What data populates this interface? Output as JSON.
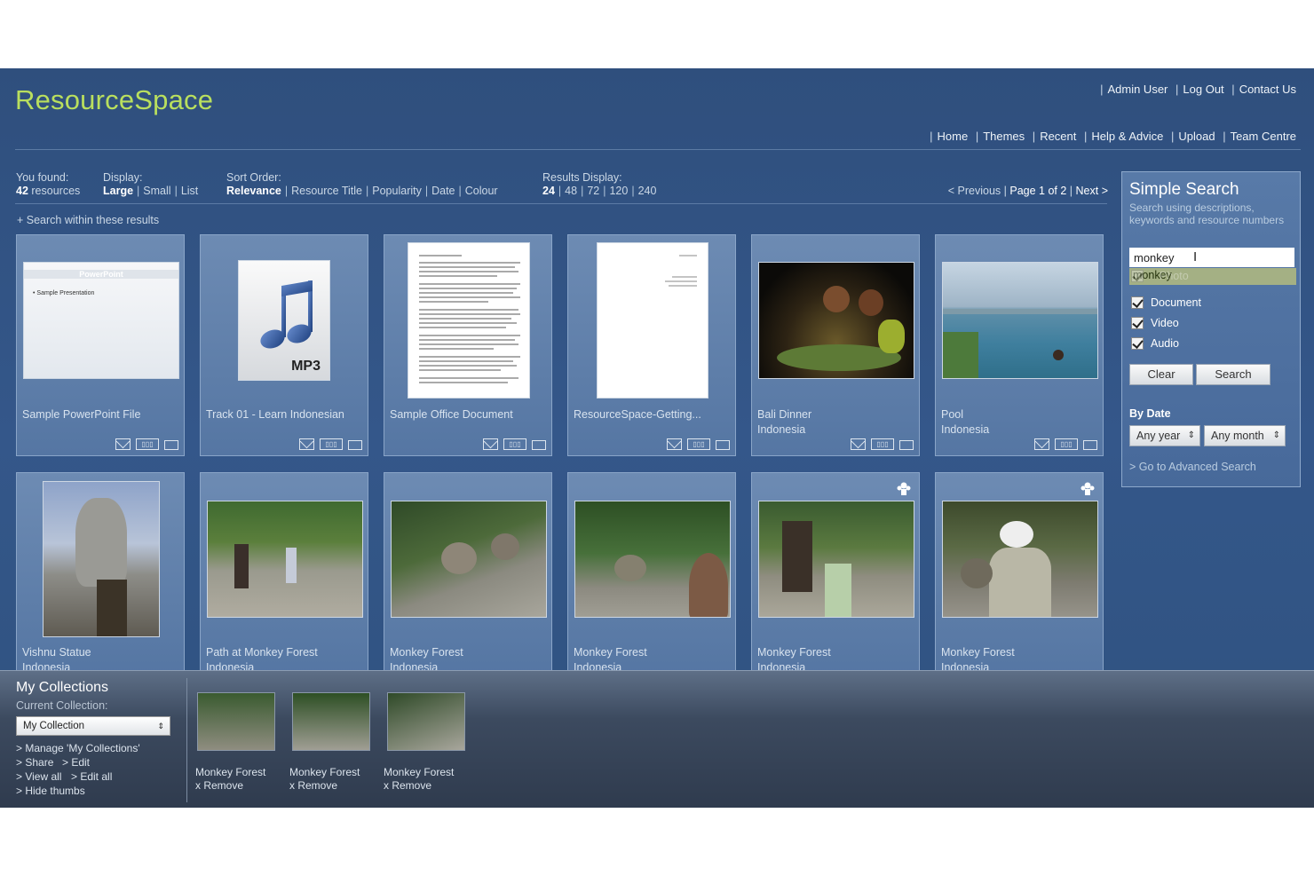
{
  "header": {
    "logo": "ResourceSpace",
    "user_links": [
      "Admin User",
      "Log Out",
      "Contact Us"
    ],
    "nav_links": [
      "Home",
      "Themes",
      "Recent",
      "Help & Advice",
      "Upload",
      "Team Centre"
    ]
  },
  "results_bar": {
    "found_label": "You found:",
    "found_count": "42",
    "found_suffix": "resources",
    "display_label": "Display:",
    "display_options": [
      "Large",
      "Small",
      "List"
    ],
    "sort_label": "Sort Order:",
    "sort_options": [
      "Relevance",
      "Resource Title",
      "Popularity",
      "Date",
      "Colour"
    ],
    "results_display_label": "Results Display:",
    "results_display_options": [
      "24",
      "48",
      "72",
      "120",
      "240"
    ],
    "pager": {
      "previous": "< Previous",
      "page_text": "Page 1 of 2",
      "next": "Next >"
    },
    "search_within": "+ Search within these results"
  },
  "resources": [
    {
      "title": "Sample PowerPoint File",
      "subtitle": "",
      "thumb": "powerpoint"
    },
    {
      "title": "Track 01 - Learn Indonesian",
      "subtitle": "",
      "thumb": "mp3"
    },
    {
      "title": "Sample Office Document",
      "subtitle": "",
      "thumb": "document"
    },
    {
      "title": "ResourceSpace-Getting...",
      "subtitle": "",
      "thumb": "getting-started"
    },
    {
      "title": "Bali Dinner",
      "subtitle": "Indonesia",
      "thumb": "dinner-photo"
    },
    {
      "title": "Pool",
      "subtitle": "Indonesia",
      "thumb": "pool-photo"
    },
    {
      "title": "Vishnu Statue",
      "subtitle": "Indonesia",
      "thumb": "statue-photo"
    },
    {
      "title": "Path at Monkey Forest",
      "subtitle": "Indonesia",
      "thumb": "path-photo"
    },
    {
      "title": "Monkey Forest",
      "subtitle": "Indonesia",
      "thumb": "monkey-photo"
    },
    {
      "title": "Monkey Forest",
      "subtitle": "Indonesia",
      "thumb": "monkey-photo"
    },
    {
      "title": "Monkey Forest",
      "subtitle": "Indonesia",
      "thumb": "forest-walk-photo"
    },
    {
      "title": "Monkey Forest",
      "subtitle": "Indonesia",
      "thumb": "man-monkey-photo"
    }
  ],
  "thumb_text": {
    "powerpoint_title": "PowerPoint",
    "powerpoint_bullet": "• Sample Presentation",
    "mp3_label": "MP3"
  },
  "simple_search": {
    "title": "Simple Search",
    "description": "Search using descriptions, keywords and resource numbers",
    "query": "monkey",
    "autocomplete": "monkey",
    "types": [
      {
        "label": "Photo",
        "checked": true
      },
      {
        "label": "Document",
        "checked": true
      },
      {
        "label": "Video",
        "checked": true
      },
      {
        "label": "Audio",
        "checked": true
      }
    ],
    "clear_label": "Clear",
    "search_label": "Search",
    "by_date_label": "By Date",
    "year_value": "Any year",
    "month_value": "Any month",
    "advanced_link": "> Go to Advanced Search"
  },
  "collections": {
    "title": "My Collections",
    "current_label": "Current Collection:",
    "current_value": "My Collection",
    "links": [
      "> Manage 'My Collections'",
      "> Share",
      "> Edit",
      "> View all",
      "> Edit all",
      "> Hide thumbs"
    ],
    "items": [
      {
        "title": "Monkey Forest",
        "remove": "x Remove"
      },
      {
        "title": "Monkey Forest",
        "remove": "x Remove"
      },
      {
        "title": "Monkey Forest",
        "remove": "x Remove"
      }
    ]
  },
  "colors": {
    "accent": "#b9df5e",
    "background": "#34578a",
    "autocomplete": "#a4b084"
  }
}
